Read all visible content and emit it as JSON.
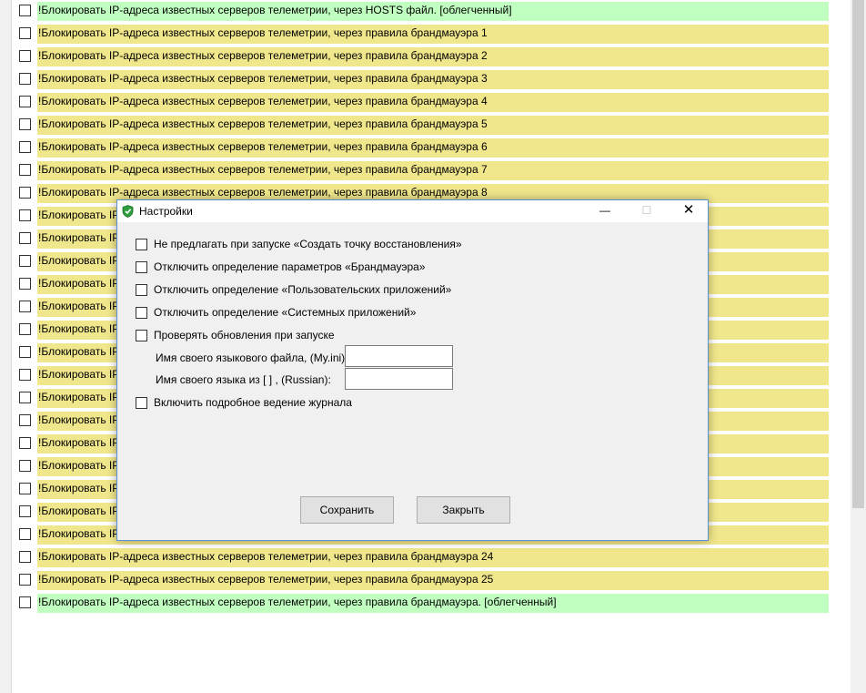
{
  "list": {
    "items": [
      {
        "label": "!Блокировать IP-адреса известных серверов телеметрии, через HOSTS файл. [облегченный]",
        "color": "green"
      },
      {
        "label": "!Блокировать IP-адреса известных серверов телеметрии, через правила брандмауэра 1",
        "color": "yellow"
      },
      {
        "label": "!Блокировать IP-адреса известных серверов телеметрии, через правила брандмауэра 2",
        "color": "yellow"
      },
      {
        "label": "!Блокировать IP-адреса известных серверов телеметрии, через правила брандмауэра 3",
        "color": "yellow"
      },
      {
        "label": "!Блокировать IP-адреса известных серверов телеметрии, через правила брандмауэра 4",
        "color": "yellow"
      },
      {
        "label": "!Блокировать IP-адреса известных серверов телеметрии, через правила брандмауэра 5",
        "color": "yellow"
      },
      {
        "label": "!Блокировать IP-адреса известных серверов телеметрии, через правила брандмауэра 6",
        "color": "yellow"
      },
      {
        "label": "!Блокировать IP-адреса известных серверов телеметрии, через правила брандмауэра 7",
        "color": "yellow"
      },
      {
        "label": "!Блокировать IP-адреса известных серверов телеметрии, через правила брандмауэра 8",
        "color": "yellow"
      },
      {
        "label": "!Блокировать IP-а",
        "color": "yellow"
      },
      {
        "label": "!Блокировать IP-а",
        "color": "yellow"
      },
      {
        "label": "!Блокировать IP-а",
        "color": "yellow"
      },
      {
        "label": "!Блокировать IP-а",
        "color": "yellow"
      },
      {
        "label": "!Блокировать IP-а",
        "color": "yellow"
      },
      {
        "label": "!Блокировать IP-а",
        "color": "yellow"
      },
      {
        "label": "!Блокировать IP-а",
        "color": "yellow"
      },
      {
        "label": "!Блокировать IP-а",
        "color": "yellow"
      },
      {
        "label": "!Блокировать IP-а",
        "color": "yellow"
      },
      {
        "label": "!Блокировать IP-а",
        "color": "yellow"
      },
      {
        "label": "!Блокировать IP-а",
        "color": "yellow"
      },
      {
        "label": "!Блокировать IP-а",
        "color": "yellow"
      },
      {
        "label": "!Блокировать IP-а",
        "color": "yellow"
      },
      {
        "label": "!Блокировать IP-а",
        "color": "yellow"
      },
      {
        "label": "!Блокировать IP-а",
        "color": "yellow"
      },
      {
        "label": "!Блокировать IP-адреса известных серверов телеметрии, через правила брандмауэра 24",
        "color": "yellow"
      },
      {
        "label": "!Блокировать IP-адреса известных серверов телеметрии, через правила брандмауэра 25",
        "color": "yellow"
      },
      {
        "label": "!Блокировать IP-адреса известных серверов телеметрии, через правила брандмауэра.  [облегченный]",
        "color": "green"
      }
    ]
  },
  "colors": {
    "yellow": "#f0e68c",
    "green": "#c1ffc1",
    "dialog_bg": "#f0f0f0"
  },
  "dialog": {
    "title": "Настройки",
    "icon": "shield-check-icon",
    "titlebar_buttons": {
      "minimize": "—",
      "maximize": "☐",
      "close": "✕"
    },
    "options": {
      "no_restore_point": "Не предлагать при запуске «Создать точку восстановления»",
      "disable_firewall_detect": "Отключить определение параметров «Брандмауэра»",
      "disable_user_apps_detect": "Отключить определение «Пользовательских приложений»",
      "disable_system_apps_detect": "Отключить определение «Системных приложений»",
      "check_updates": "Проверять обновления при запуске",
      "verbose_logging": "Включить подробное ведение журнала"
    },
    "fields": {
      "lang_file_label": "Имя своего языкового файла, (My.ini):",
      "lang_file_value": "",
      "lang_name_label": "Имя своего языка из [ ] , (Russian):",
      "lang_name_value": ""
    },
    "buttons": {
      "save": "Сохранить",
      "close": "Закрыть"
    }
  }
}
